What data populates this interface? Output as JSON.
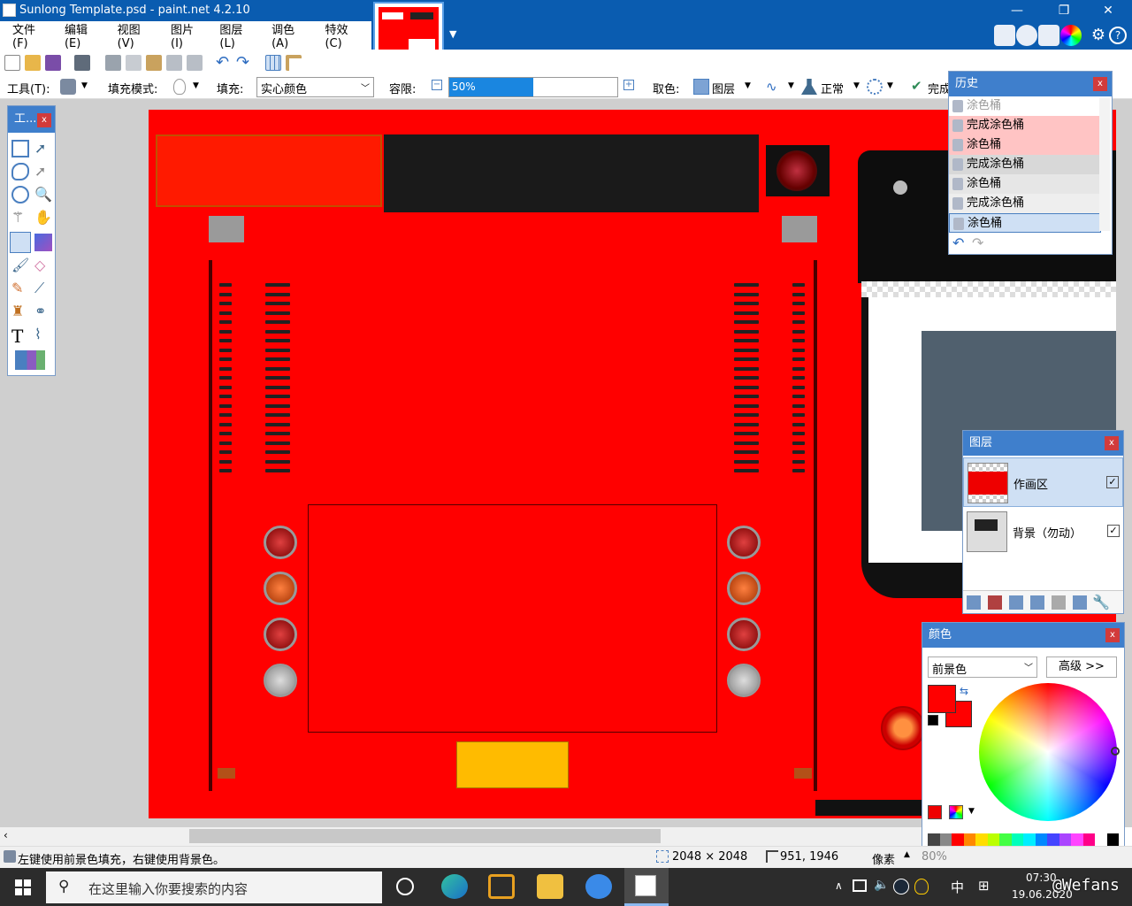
{
  "window": {
    "title": "Sunlong Template.psd - paint.net 4.2.10",
    "min": "—",
    "restore": "❐",
    "close": "✕"
  },
  "menu": [
    "文件(F)",
    "编辑(E)",
    "视图(V)",
    "图片(I)",
    "图层(L)",
    "调色(A)",
    "特效(C)"
  ],
  "toolbar": {
    "tool_label": "工具(T):",
    "fill_mode_label": "填充模式:",
    "fill_label": "填充:",
    "fill_value": "实心颜色",
    "tolerance_label": "容限:",
    "tolerance_value": "50%",
    "tolerance_fraction": 0.5,
    "sample_label": "取色:",
    "sample_value": "图层",
    "blend_value": "正常",
    "finish_label": "完成"
  },
  "tools_panel": {
    "title": "工..."
  },
  "history": {
    "title": "历史",
    "items": [
      "涂色桶",
      "完成涂色桶",
      "涂色桶",
      "完成涂色桶",
      "涂色桶",
      "完成涂色桶",
      "涂色桶"
    ],
    "selected_index": 6
  },
  "layers": {
    "title": "图层",
    "items": [
      {
        "name": "作画区",
        "checked": true
      },
      {
        "name": "背景（勿动）",
        "checked": true
      }
    ]
  },
  "colors": {
    "title": "颜色",
    "mode": "前景色",
    "advanced": "高级 >>",
    "primary": "#ff0000",
    "secondary": "#ff0000"
  },
  "status": {
    "hint": "左键使用前景色填充，右键使用背景色。",
    "size": "2048 × 2048",
    "pos": "951, 1946",
    "unit": "像素",
    "zoom": "80%"
  },
  "taskbar": {
    "search_placeholder": "在这里输入你要搜索的内容",
    "time": "07:30",
    "date": "19.06.2020",
    "ime": "中",
    "watermark": "@Wefans"
  }
}
